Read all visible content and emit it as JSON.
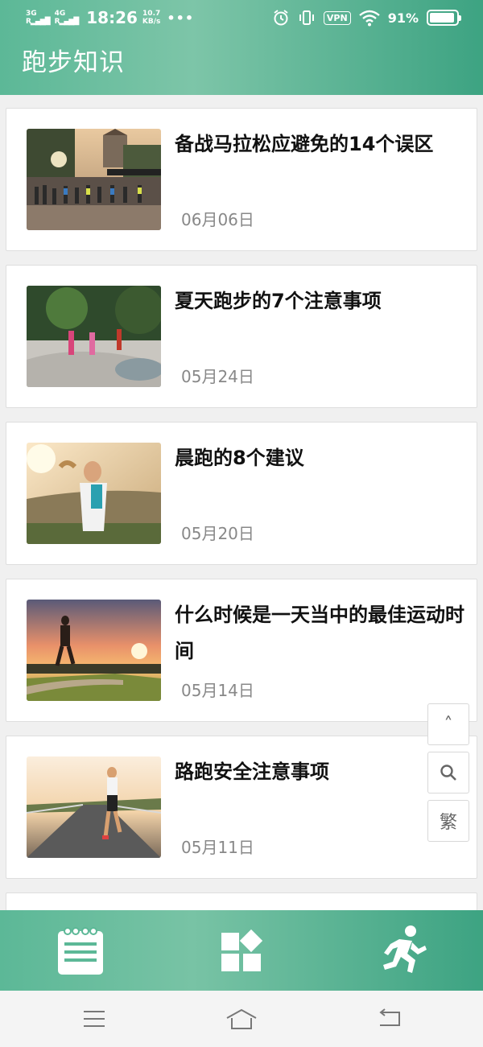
{
  "status_bar": {
    "network_1": "3G",
    "network_2": "4G",
    "time": "18:26",
    "speed_value": "10.7",
    "speed_unit": "KB/s",
    "more": "•••",
    "vpn": "VPN",
    "battery": "91%"
  },
  "header": {
    "title": "跑步知识"
  },
  "articles": [
    {
      "title": "备战马拉松应避免的14个误区",
      "date": "06月06日",
      "image": "marathon-start-photo"
    },
    {
      "title": "夏天跑步的7个注意事项",
      "date": "05月24日",
      "image": "park-runners-photo"
    },
    {
      "title": "晨跑的8个建议",
      "date": "05月20日",
      "image": "morning-runner-woman-photo"
    },
    {
      "title": "什么时候是一天当中的最佳运动时间",
      "date": "05月14日",
      "image": "sunset-runner-photo"
    },
    {
      "title": "路跑安全注意事项",
      "date": "05月11日",
      "image": "road-runner-photo"
    }
  ],
  "float_buttons": {
    "up": "˄",
    "search": "search-icon",
    "traditional": "繁"
  },
  "tabbar": {
    "items": [
      "notepad-icon",
      "grid-icon",
      "runner-icon"
    ]
  },
  "system_nav": {
    "items": [
      "menu-icon",
      "home-icon",
      "back-icon"
    ]
  },
  "colors": {
    "accent": "#4fb08d",
    "accent_dark": "#3da382",
    "date": "#888888"
  }
}
